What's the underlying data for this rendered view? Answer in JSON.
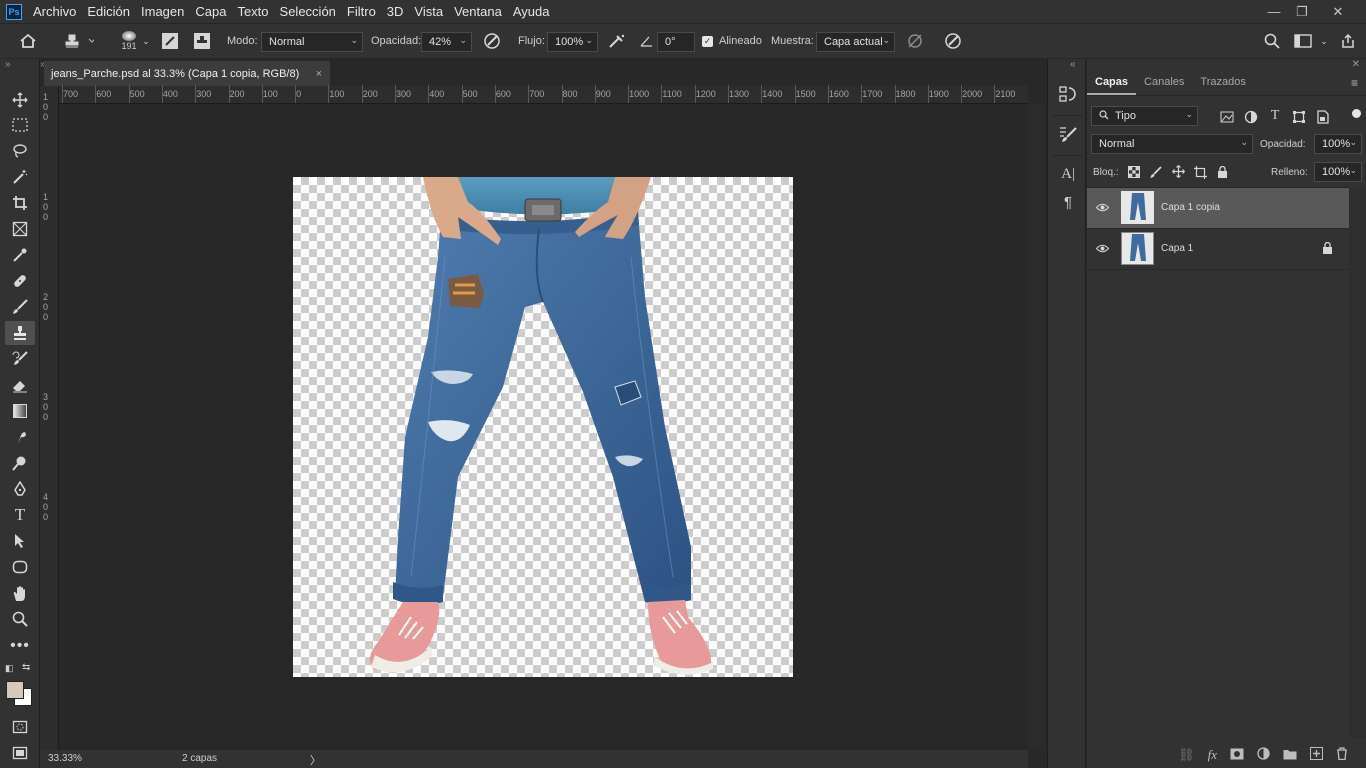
{
  "menu": {
    "logo": "Ps",
    "items": [
      "Archivo",
      "Edición",
      "Imagen",
      "Capa",
      "Texto",
      "Selección",
      "Filtro",
      "3D",
      "Vista",
      "Ventana",
      "Ayuda"
    ]
  },
  "window": {
    "minimize": "—",
    "restore": "❐",
    "close": "✕"
  },
  "options": {
    "brush_size": "191",
    "mode_label": "Modo:",
    "mode_value": "Normal",
    "opacity_label": "Opacidad:",
    "opacity_value": "42%",
    "flow_label": "Flujo:",
    "flow_value": "100%",
    "angle_value": "0°",
    "aligned_label": "Alineado",
    "sample_label": "Muestra:",
    "sample_value": "Capa actual"
  },
  "document": {
    "tab_title": "jeans_Parche.psd al 33.3% (Capa 1 copia, RGB/8)",
    "close": "×"
  },
  "ruler": {
    "h_labels": [
      "700",
      "600",
      "500",
      "400",
      "300",
      "200",
      "100",
      "0",
      "100",
      "200",
      "300",
      "400",
      "500",
      "600",
      "700",
      "800",
      "900",
      "1000",
      "1100",
      "1200",
      "1300",
      "1400",
      "1500",
      "1600",
      "1700",
      "1800",
      "1900",
      "2000",
      "2100"
    ],
    "v_labels": [
      "1",
      "0",
      "0",
      "1",
      "0",
      "0",
      "2",
      "0",
      "0",
      "3",
      "0",
      "0",
      "4",
      "0",
      "0"
    ]
  },
  "status": {
    "zoom": "33.33%",
    "info": "2 capas",
    "arrow": "〉"
  },
  "panel": {
    "tabs": [
      "Capas",
      "Canales",
      "Trazados"
    ],
    "filter_value": "Tipo",
    "blend_value": "Normal",
    "opacity_label": "Opacidad:",
    "opacity_value": "100%",
    "lock_label": "Bloq.:",
    "fill_label": "Relleno:",
    "fill_value": "100%",
    "layers": [
      {
        "name": "Capa 1 copia",
        "selected": true,
        "locked": false
      },
      {
        "name": "Capa 1",
        "selected": false,
        "locked": true
      }
    ]
  },
  "colors": {
    "accent": "#31a8ff",
    "foreground_swatch": "#d5c9b9",
    "background_swatch": "#ffffff",
    "denim": "#3f6b9e"
  }
}
